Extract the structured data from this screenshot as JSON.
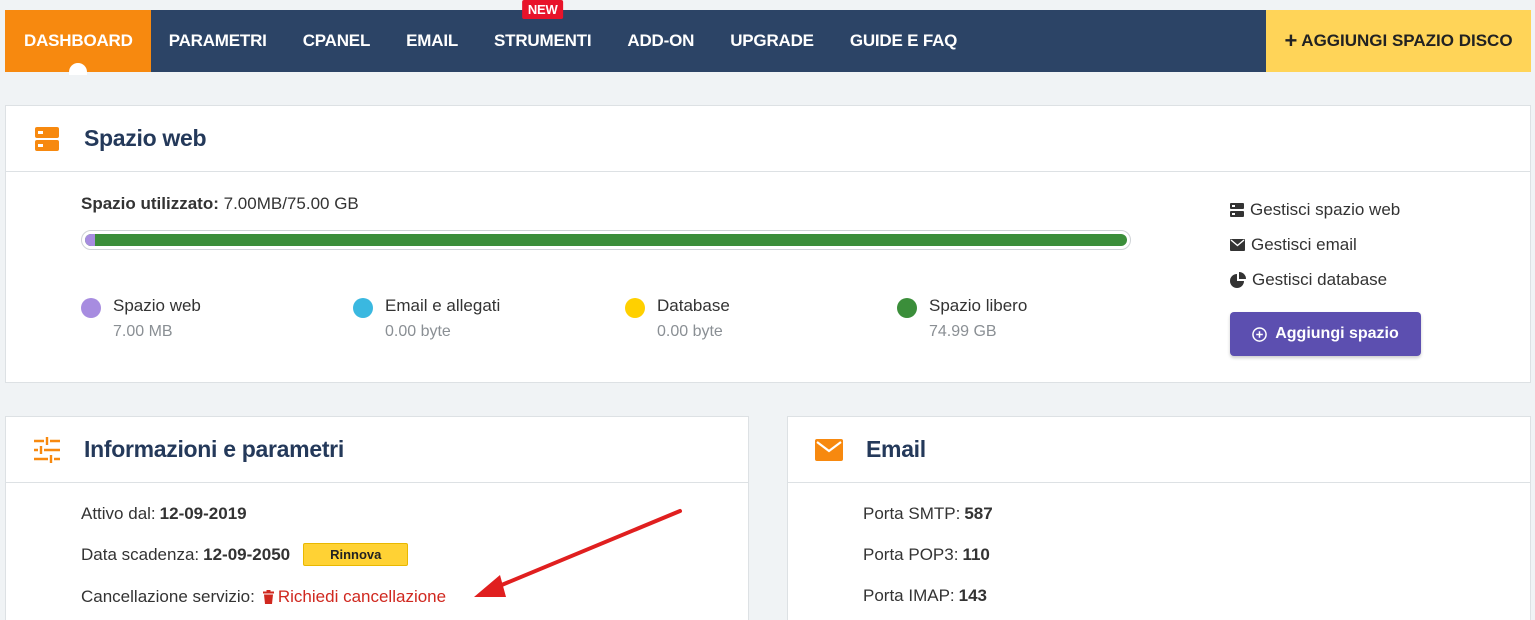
{
  "nav": {
    "items": [
      {
        "label": "DASHBOARD",
        "active": true
      },
      {
        "label": "PARAMETRI"
      },
      {
        "label": "CPANEL"
      },
      {
        "label": "EMAIL"
      },
      {
        "label": "STRUMENTI",
        "badge": "NEW"
      },
      {
        "label": "ADD-ON"
      },
      {
        "label": "UPGRADE"
      },
      {
        "label": "GUIDE E FAQ"
      }
    ],
    "cta_label": "AGGIUNGI SPAZIO DISCO",
    "cta_plus": "+"
  },
  "web": {
    "title": "Spazio web",
    "used_label": "Spazio utilizzato:",
    "used_value": "7.00MB/75.00 GB",
    "legend": [
      {
        "title": "Spazio web",
        "value": "7.00 MB",
        "color": "#a78ce0"
      },
      {
        "title": "Email e allegati",
        "value": "0.00 byte",
        "color": "#3ab8e0"
      },
      {
        "title": "Database",
        "value": "0.00 byte",
        "color": "#ffd000"
      },
      {
        "title": "Spazio libero",
        "value": "74.99 GB",
        "color": "#3b8e3a"
      }
    ],
    "links": [
      {
        "label": "Gestisci spazio web",
        "icon": "server-icon"
      },
      {
        "label": "Gestisci email",
        "icon": "envelope-icon"
      },
      {
        "label": "Gestisci database",
        "icon": "pie-chart-icon"
      }
    ],
    "add_button": "Aggiungi spazio"
  },
  "info": {
    "title": "Informazioni e parametri",
    "active_label": "Attivo dal:",
    "active_value": "12-09-2019",
    "expiry_label": "Data scadenza:",
    "expiry_value": "12-09-2050",
    "renew_button": "Rinnova",
    "cancel_label": "Cancellazione servizio:",
    "cancel_link": "Richiedi cancellazione"
  },
  "mail": {
    "title": "Email",
    "smtp_label": "Porta SMTP:",
    "smtp_value": "587",
    "pop3_label": "Porta POP3:",
    "pop3_value": "110",
    "imap_label": "Porta IMAP:",
    "imap_value": "143"
  },
  "colors": {
    "nav_bg": "#2c4466",
    "active": "#f7890f",
    "cta": "#ffd458",
    "accent_purple": "#5c4fb0",
    "danger": "#d0281f"
  }
}
